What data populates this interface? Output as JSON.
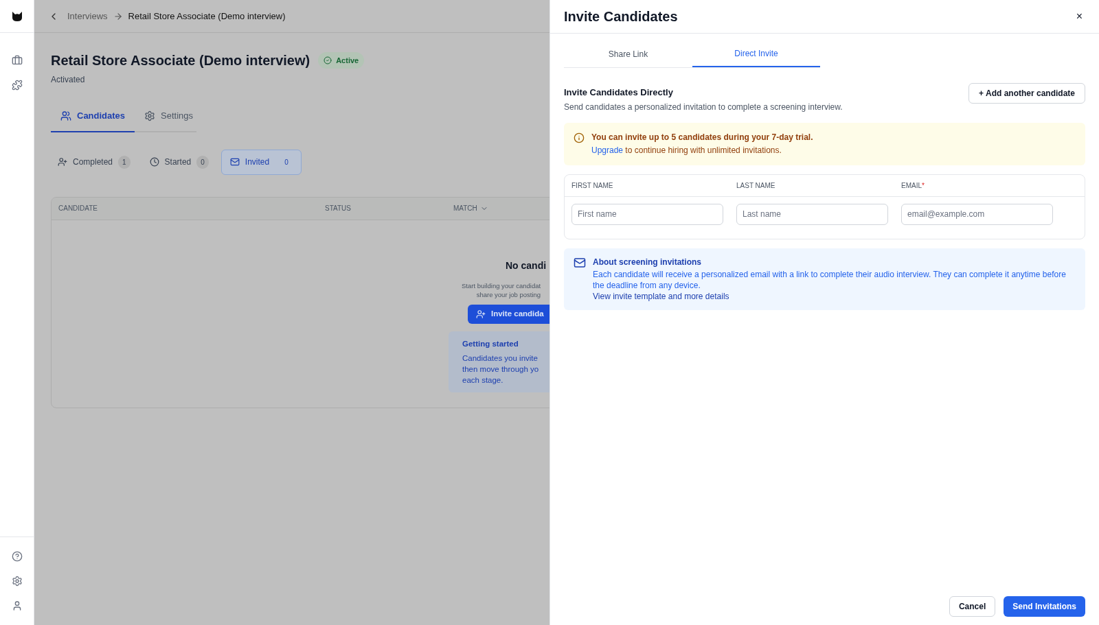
{
  "breadcrumb": {
    "parent": "Interviews",
    "current": "Retail Store Associate (Demo interview)"
  },
  "page": {
    "title": "Retail Store Associate (Demo interview)",
    "status": "Active",
    "subtitle": "Activated"
  },
  "tabs": [
    {
      "label": "Candidates",
      "kind": "people",
      "selected": true
    },
    {
      "label": "Settings",
      "kind": "gear",
      "selected": false
    }
  ],
  "filters": [
    {
      "label": "Completed",
      "count": "1",
      "kind": "person",
      "selected": false
    },
    {
      "label": "Started",
      "count": "0",
      "kind": "clock",
      "selected": false
    },
    {
      "label": "Invited",
      "count": "0",
      "kind": "mail",
      "selected": true
    }
  ],
  "table": {
    "columns": [
      "CANDIDATE",
      "STATUS",
      "MATCH"
    ]
  },
  "empty_state": {
    "title": "No candi",
    "lines": [
      "Start building your candidat",
      "share your job posting"
    ],
    "button": "Invite candida",
    "tip_title": "Getting started",
    "tip_lines": [
      "Candidates you invite",
      "then move through yo",
      "each stage."
    ]
  },
  "drawer": {
    "title": "Invite Candidates",
    "close": "×",
    "tabs": [
      {
        "label": "Share Link",
        "selected": false
      },
      {
        "label": "Direct Invite",
        "selected": true
      }
    ],
    "heading": "Invite Candidates Directly",
    "description": "Send candidates a personalized invitation to complete a screening interview.",
    "add_button": "+ Add another candidate",
    "notice": {
      "line1": "You can invite up to 5 candidates during your 7-day trial.",
      "link": "Upgrade",
      "line2": " to continue hiring with unlimited invitations."
    },
    "form": {
      "columns": [
        {
          "label": "FIRST NAME",
          "required": false
        },
        {
          "label": "LAST NAME",
          "required": false
        },
        {
          "label": "EMAIL",
          "required": true
        }
      ],
      "required_mark": "*",
      "placeholders": [
        "First name",
        "Last name",
        "email@example.com"
      ]
    },
    "info": {
      "title": "About screening invitations",
      "text": "Each candidate will receive a personalized email with a link to complete their audio interview. They can complete it anytime before the deadline from any device.",
      "link": "View invite template and more details"
    },
    "buttons": {
      "cancel": "Cancel",
      "submit": "Send Invitations"
    }
  }
}
